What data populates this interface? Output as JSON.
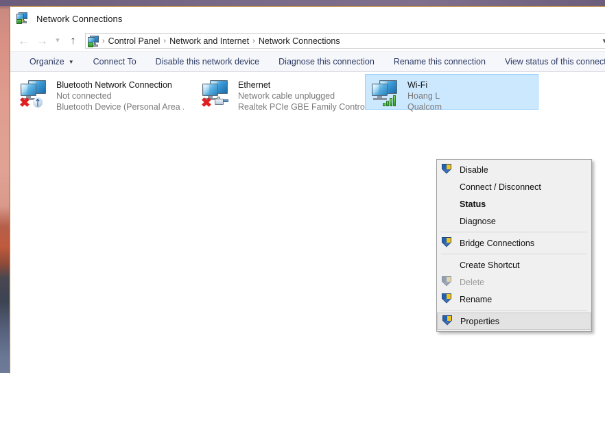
{
  "window": {
    "title": "Network Connections",
    "title_icon": "network-connection-icon"
  },
  "navbar": {
    "back_icon": "back-arrow-icon",
    "forward_icon": "forward-arrow-icon",
    "history_icon": "chevron-down-icon",
    "up_icon": "up-arrow-icon",
    "address_icon": "network-connection-icon",
    "address_dropdown_icon": "chevron-down-icon",
    "breadcrumbs": [
      "Control Panel",
      "Network and Internet",
      "Network Connections"
    ],
    "separator": "›"
  },
  "commandbar": {
    "items": [
      {
        "label": "Organize",
        "has_caret": true
      },
      {
        "label": "Connect To",
        "has_caret": false
      },
      {
        "label": "Disable this network device",
        "has_caret": false
      },
      {
        "label": "Diagnose this connection",
        "has_caret": false
      },
      {
        "label": "Rename this connection",
        "has_caret": false
      },
      {
        "label": "View status of this connection",
        "has_caret": false
      }
    ]
  },
  "connections": [
    {
      "name": "Bluetooth Network Connection",
      "status": "Not connected",
      "device": "Bluetooth Device (Personal Area ...",
      "selected": false,
      "badge_icon": "bluetooth-icon",
      "error_icon": "red-x-icon",
      "adapter_icon": "network-adapter-icon"
    },
    {
      "name": "Ethernet",
      "status": "Network cable unplugged",
      "device": "Realtek PCIe GBE Family Controller",
      "selected": false,
      "badge_icon": "rj45-cable-icon",
      "error_icon": "red-x-icon",
      "adapter_icon": "network-adapter-icon"
    },
    {
      "name": "Wi-Fi",
      "status": "Hoang L",
      "device": "Qualcom",
      "selected": true,
      "badge_icon": "wifi-signal-bars-icon",
      "error_icon": "",
      "adapter_icon": "network-adapter-icon"
    }
  ],
  "context_menu": {
    "items": [
      {
        "label": "Disable",
        "shield": true,
        "bold": false,
        "disabled": false,
        "hover": false,
        "separator_after": false
      },
      {
        "label": "Connect / Disconnect",
        "shield": false,
        "bold": false,
        "disabled": false,
        "hover": false,
        "separator_after": false
      },
      {
        "label": "Status",
        "shield": false,
        "bold": true,
        "disabled": false,
        "hover": false,
        "separator_after": false
      },
      {
        "label": "Diagnose",
        "shield": false,
        "bold": false,
        "disabled": false,
        "hover": false,
        "separator_after": true
      },
      {
        "label": "Bridge Connections",
        "shield": true,
        "bold": false,
        "disabled": false,
        "hover": false,
        "separator_after": true
      },
      {
        "label": "Create Shortcut",
        "shield": false,
        "bold": false,
        "disabled": false,
        "hover": false,
        "separator_after": false
      },
      {
        "label": "Delete",
        "shield": true,
        "bold": false,
        "disabled": true,
        "hover": false,
        "separator_after": false
      },
      {
        "label": "Rename",
        "shield": true,
        "bold": false,
        "disabled": false,
        "hover": false,
        "separator_after": true
      },
      {
        "label": "Properties",
        "shield": true,
        "bold": false,
        "disabled": false,
        "hover": true,
        "separator_after": false
      }
    ]
  },
  "colors": {
    "selection_fill": "#cce8ff",
    "selection_border": "#99d1ff",
    "command_text": "#2b3a63",
    "menu_background": "#f0f0f0",
    "menu_hover": "#e3e3e3",
    "disabled_text": "#9a9a9a",
    "subtext": "#7a7a7a",
    "error_red": "#e02020",
    "shield_blue": "#1f62b0",
    "shield_gold": "#f2c31a",
    "window_border": "#b5915f"
  }
}
